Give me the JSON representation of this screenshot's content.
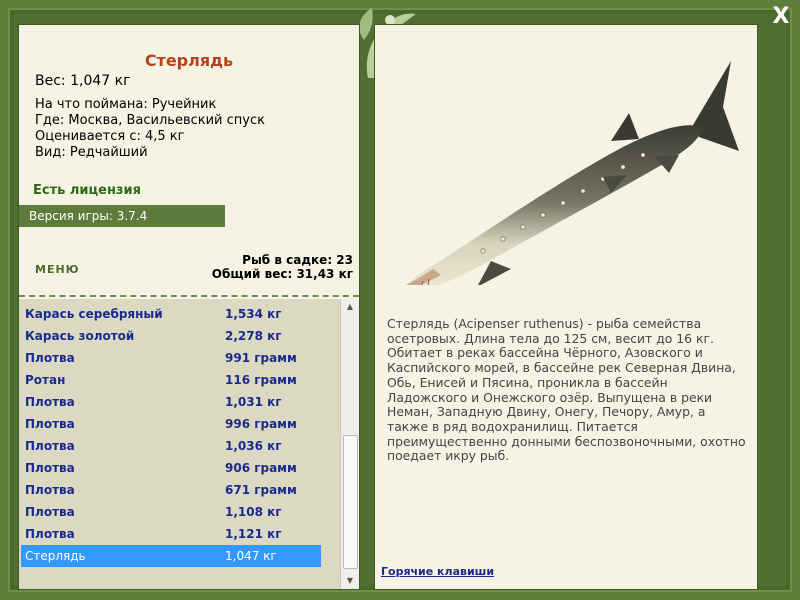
{
  "window": {
    "close_label": "X"
  },
  "fish_card": {
    "title": "Стерлядь",
    "weight": "Вес: 1,047 кг",
    "bait": "На что поймана: Ручейник",
    "location": "Где: Москва, Васильевский спуск",
    "value": "Оценивается с: 4,5 кг",
    "rarity": "Вид: Редчайший"
  },
  "license_text": "Есть лицензия",
  "version_text": "Версия игры: 3.7.4",
  "menu_label": "МЕНЮ",
  "stats": {
    "fish_in_cage": "Рыб в садке: 23",
    "total_weight": "Общий вес: 31,43 кг"
  },
  "catch_list": [
    {
      "name": "Карась серебряный",
      "weight": "1,534 кг"
    },
    {
      "name": "Карась золотой",
      "weight": "2,278 кг"
    },
    {
      "name": "Плотва",
      "weight": "991 грамм"
    },
    {
      "name": "Ротан",
      "weight": "116 грамм"
    },
    {
      "name": "Плотва",
      "weight": "1,031 кг"
    },
    {
      "name": "Плотва",
      "weight": "996 грамм"
    },
    {
      "name": "Плотва",
      "weight": "1,036 кг"
    },
    {
      "name": "Плотва",
      "weight": "906 грамм"
    },
    {
      "name": "Плотва",
      "weight": "671 грамм"
    },
    {
      "name": "Плотва",
      "weight": "1,108 кг"
    },
    {
      "name": "Плотва",
      "weight": "1,121 кг"
    },
    {
      "name": "Стерлядь",
      "weight": "1,047 кг",
      "selected": true
    }
  ],
  "description": "Стерлядь (Acipenser ruthenus) - рыба семейства осетровых. Длина тела до 125 см, весит до 16 кг. Обитает в реках бассейна Чёрного, Азовского и Каспийского морей, в бассейне рек Северная Двина, Обь, Енисей и Пясина, проникла в бассейн Ладожского и Онежского озёр. Выпущена в реки Неман, Западную Двину, Онегу, Печору, Амур, а также в ряд водохранилищ. Питается преимущественно донными беспозвоночными, охотно поедает икру рыб.",
  "hotkeys_label": "Горячие клавиши",
  "icons": {
    "close": "close-icon",
    "ornament": "leaf-ornament-icon",
    "scroll_up": "arrow-up-icon",
    "scroll_down": "arrow-down-icon"
  },
  "colors": {
    "frame": "#5f7f3c",
    "panel": "#f5f3e4",
    "title": "#b8421c",
    "license": "#2f6a16",
    "list_text": "#1a2a8c",
    "selection": "#3399ff"
  }
}
